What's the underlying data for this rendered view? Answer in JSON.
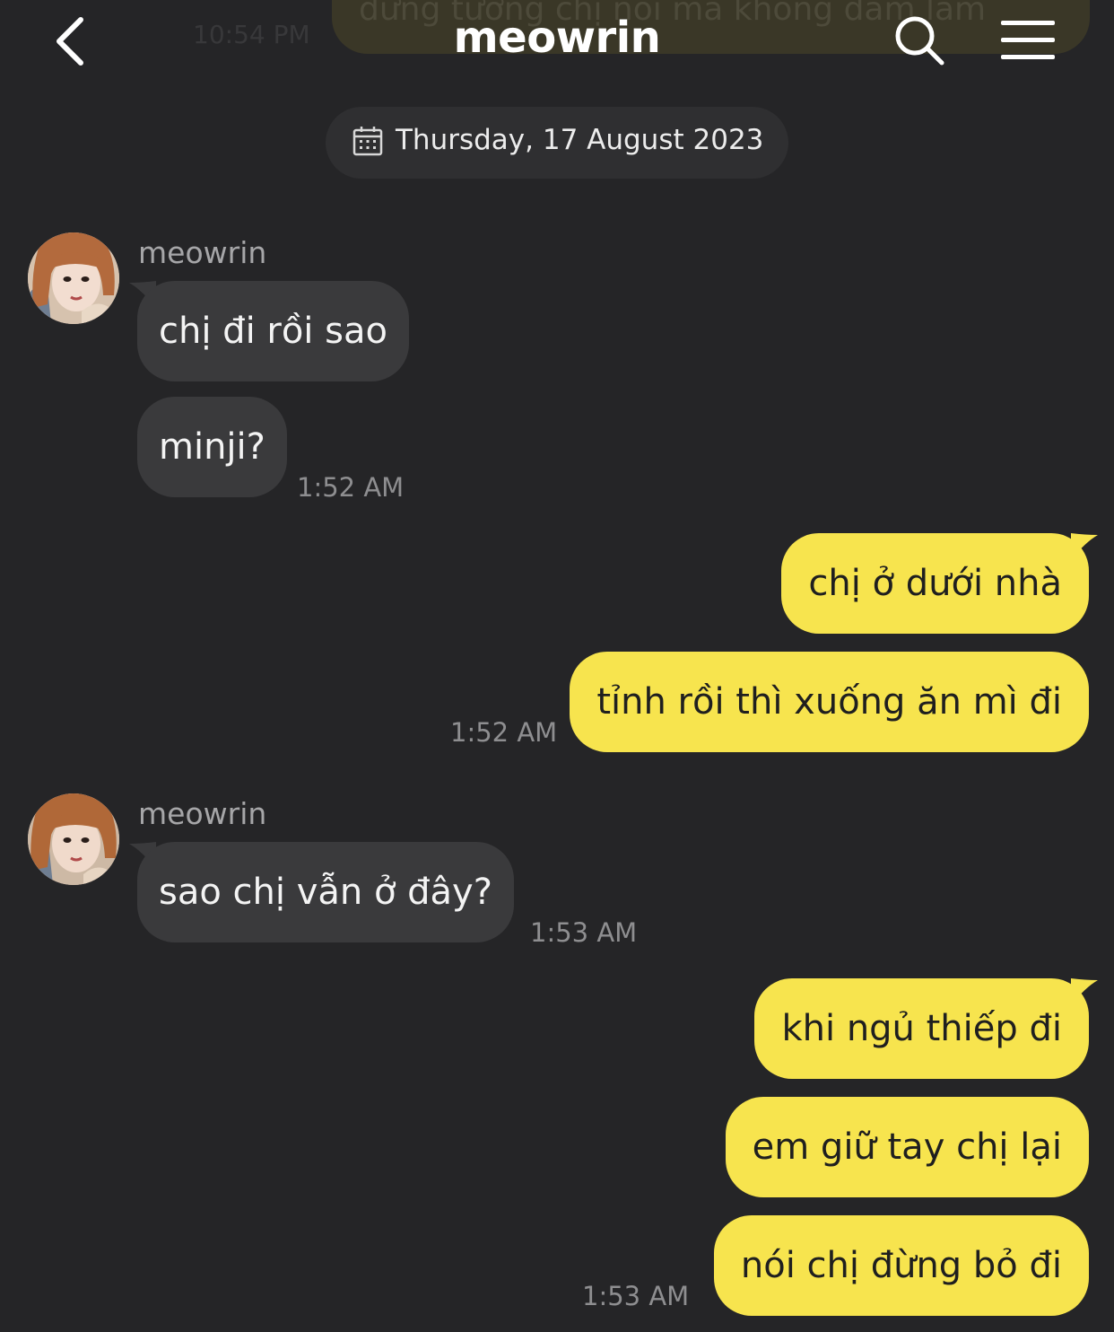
{
  "header": {
    "title": "meowrin",
    "back_icon": "chevron-left-icon",
    "search_icon": "search-icon",
    "menu_icon": "menu-icon"
  },
  "previous": {
    "message_text": "đừng tưởng chị nói mà không dám làm",
    "time": "10:54 PM"
  },
  "date_divider": {
    "icon": "calendar-icon",
    "label": "Thursday, 17 August 2023"
  },
  "groups": [
    {
      "sender": "meowrin",
      "messages": [
        "chị đi rồi sao",
        "minji?"
      ],
      "time": "1:52 AM"
    },
    {
      "sender": "me",
      "messages": [
        "chị ở dưới nhà",
        "tỉnh rồi thì xuống ăn mì đi"
      ],
      "time": "1:52 AM"
    },
    {
      "sender": "meowrin",
      "messages": [
        "sao chị vẫn ở đây?"
      ],
      "time": "1:53 AM"
    },
    {
      "sender": "me",
      "messages": [
        "khi ngủ thiếp đi",
        "em giữ tay chị lại",
        "nói chị đừng bỏ đi"
      ],
      "time": "1:53 AM"
    }
  ],
  "colors": {
    "background": "#252527",
    "incoming_bubble": "#3a3a3c",
    "outgoing_bubble": "#f7e44e",
    "timestamp": "#8e8e90"
  }
}
